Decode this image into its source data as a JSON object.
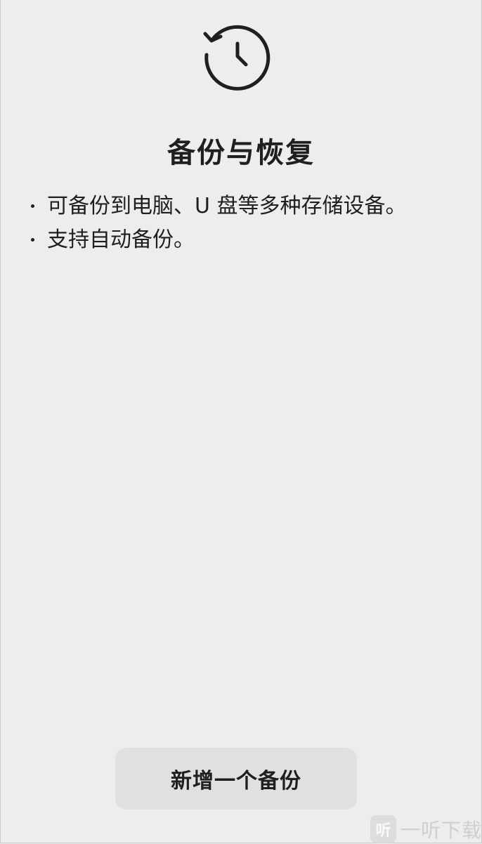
{
  "header": {
    "icon": "history-clock-icon",
    "title": "备份与恢复"
  },
  "features": [
    {
      "text": "可备份到电脑、U 盘等多种存储设备。"
    },
    {
      "text": "支持自动备份。"
    }
  ],
  "actions": {
    "add_backup_label": "新增一个备份"
  },
  "watermark": {
    "logo_char": "听",
    "text": "一听下载"
  },
  "colors": {
    "background": "#ededed",
    "text": "#1f1f1f",
    "button_bg": "#e0e0e0"
  }
}
